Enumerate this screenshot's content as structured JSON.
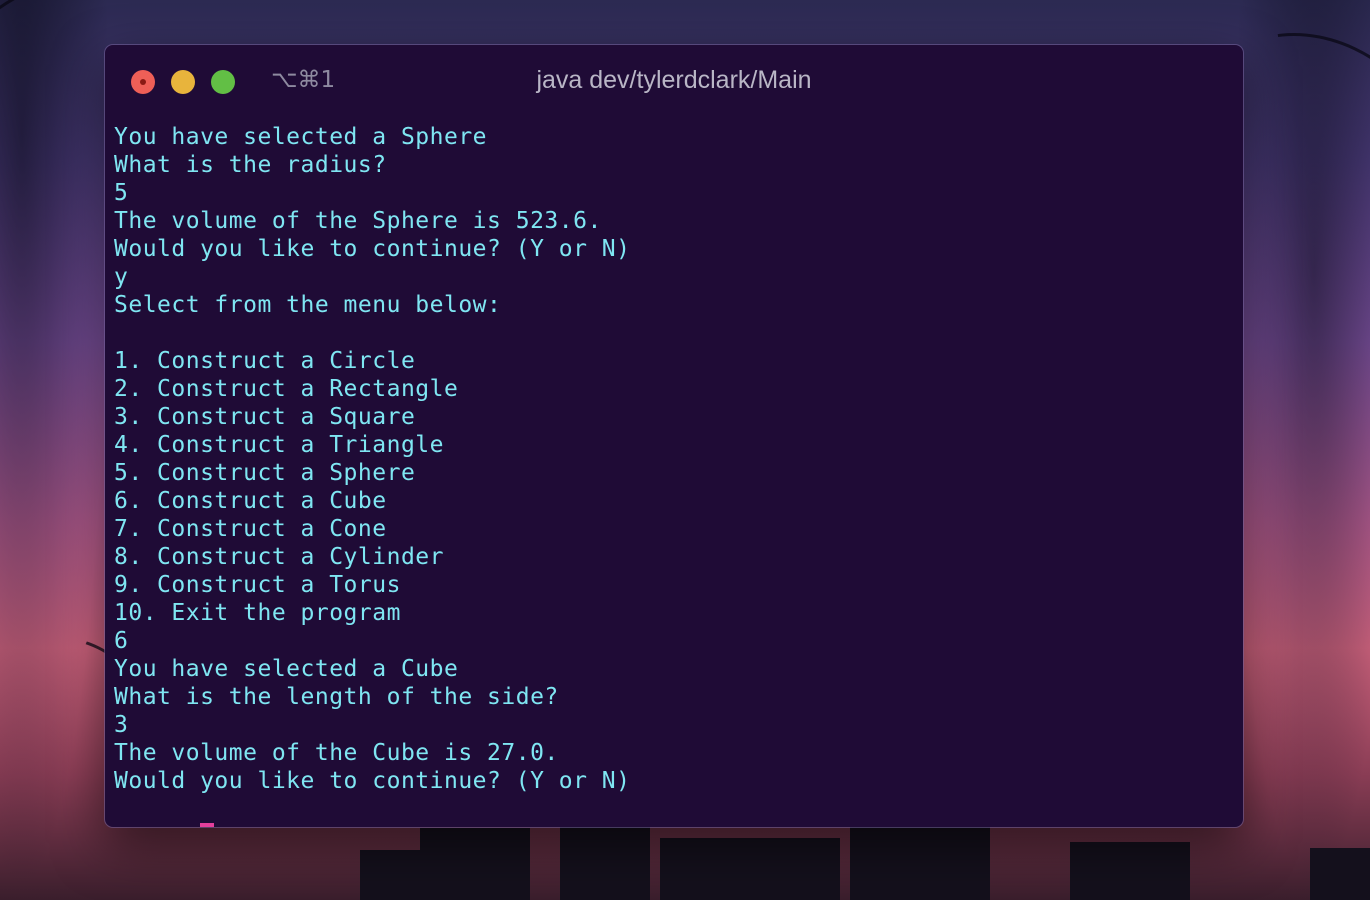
{
  "window": {
    "shortcut": "⌥⌘1",
    "title": "java dev/tylerdclark/Main",
    "traffic_lights": {
      "close": "#ee5f57",
      "minimize": "#e8b43c",
      "maximize": "#62bf45"
    }
  },
  "colors": {
    "terminal_bg": "#1f0b36",
    "text": "#7fe6f2",
    "cursor": "#e43f9c"
  },
  "terminal": {
    "lines": [
      "You have selected a Sphere",
      "What is the radius?",
      "5",
      "The volume of the Sphere is 523.6.",
      "Would you like to continue? (Y or N)",
      "y",
      "Select from the menu below:",
      "",
      "1. Construct a Circle",
      "2. Construct a Rectangle",
      "3. Construct a Square",
      "4. Construct a Triangle",
      "5. Construct a Sphere",
      "6. Construct a Cube",
      "7. Construct a Cone",
      "8. Construct a Cylinder",
      "9. Construct a Torus",
      "10. Exit the program",
      "6",
      "You have selected a Cube",
      "What is the length of the side?",
      "3",
      "The volume of the Cube is 27.0.",
      "Would you like to continue? (Y or N)"
    ]
  }
}
